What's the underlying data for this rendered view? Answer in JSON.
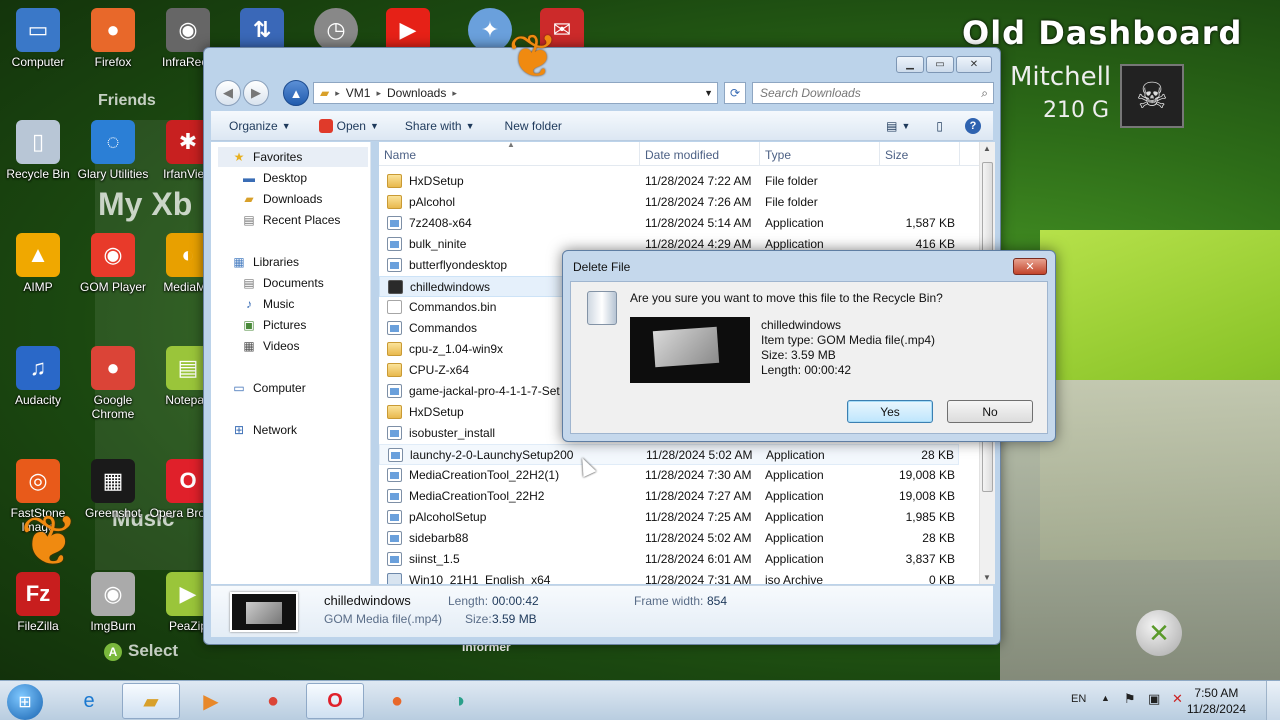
{
  "desktop": {
    "icons": [
      {
        "label": "Computer",
        "glyph": "▭",
        "color": "#3a78c8"
      },
      {
        "label": "Firefox",
        "glyph": "●",
        "color": "#e8682a"
      },
      {
        "label": "InfraReco",
        "glyph": "◉",
        "color": "#666666"
      },
      {
        "label": "Recycle Bin",
        "glyph": "▯",
        "color": "#b8c6d6"
      },
      {
        "label": "Glary Utilities",
        "glyph": "◌",
        "color": "#2b7fd6"
      },
      {
        "label": "IrfanView",
        "glyph": "✱",
        "color": "#c82020"
      },
      {
        "label": "AIMP",
        "glyph": "▲",
        "color": "#f0a800"
      },
      {
        "label": "GOM Player",
        "glyph": "◉",
        "color": "#e83a2a"
      },
      {
        "label": "MediaMo",
        "glyph": "◐",
        "color": "#e8a000"
      },
      {
        "label": "Audacity",
        "glyph": "♫",
        "color": "#2a68c8"
      },
      {
        "label": "Google Chrome",
        "glyph": "●",
        "color": "#db4437"
      },
      {
        "label": "Notepad",
        "glyph": "▤",
        "color": "#9ac53a"
      },
      {
        "label": "FastStone Image",
        "glyph": "◎",
        "color": "#e85a1a"
      },
      {
        "label": "Greenshot",
        "glyph": "▦",
        "color": "#1a1a1a"
      },
      {
        "label": "Opera Browse",
        "glyph": "O",
        "color": "#e0202a"
      },
      {
        "label": "FileZilla",
        "glyph": "Fz",
        "color": "#c81e1e"
      },
      {
        "label": "ImgBurn",
        "glyph": "◉",
        "color": "#aaaaaa"
      },
      {
        "label": "PeaZip",
        "glyph": "▶",
        "color": "#9ac53a"
      }
    ],
    "top_row_icons": [
      "network-icon",
      "clock-icon",
      "youtube-icon",
      "satellite-icon",
      "mail-icon"
    ],
    "gamer_title": "Old Dashboard",
    "gamer_name": "Mitchell",
    "gamer_score": "210 G",
    "bg_texts": {
      "friends": "Friends",
      "my_xbox": "My Xb",
      "music": "Music",
      "select": "Select",
      "informer": "Informer"
    }
  },
  "explorer": {
    "breadcrumb": [
      "VM1",
      "Downloads"
    ],
    "search_placeholder": "Search Downloads",
    "toolbar": {
      "organize": "Organize",
      "open": "Open",
      "share_with": "Share with",
      "new_folder": "New folder"
    },
    "nav": {
      "favorites": "Favorites",
      "desktop": "Desktop",
      "downloads": "Downloads",
      "recent_places": "Recent Places",
      "libraries": "Libraries",
      "documents": "Documents",
      "music": "Music",
      "pictures": "Pictures",
      "videos": "Videos",
      "computer": "Computer",
      "network": "Network"
    },
    "columns": {
      "name": "Name",
      "date": "Date modified",
      "type": "Type",
      "size": "Size"
    },
    "files": [
      {
        "name": "HxDSetup",
        "date": "11/28/2024 7:22 AM",
        "type": "File folder",
        "size": "",
        "icon": "folder"
      },
      {
        "name": "pAlcohol",
        "date": "11/28/2024 7:26 AM",
        "type": "File folder",
        "size": "",
        "icon": "folder"
      },
      {
        "name": "7z2408-x64",
        "date": "11/28/2024 5:14 AM",
        "type": "Application",
        "size": "1,587 KB",
        "icon": "app"
      },
      {
        "name": "bulk_ninite",
        "date": "11/28/2024 4:29 AM",
        "type": "Application",
        "size": "416 KB",
        "icon": "app"
      },
      {
        "name": "butterflyondesktop",
        "date": "",
        "type": "",
        "size": "",
        "icon": "app"
      },
      {
        "name": "chilledwindows",
        "date": "",
        "type": "",
        "size": "",
        "icon": "media"
      },
      {
        "name": "Commandos.bin",
        "date": "",
        "type": "",
        "size": "",
        "icon": "file"
      },
      {
        "name": "Commandos",
        "date": "",
        "type": "",
        "size": "",
        "icon": "app"
      },
      {
        "name": "cpu-z_1.04-win9x",
        "date": "",
        "type": "",
        "size": "",
        "icon": "folder"
      },
      {
        "name": "CPU-Z-x64",
        "date": "",
        "type": "",
        "size": "",
        "icon": "folder"
      },
      {
        "name": "game-jackal-pro-4-1-1-7-Set",
        "date": "",
        "type": "",
        "size": "",
        "icon": "app"
      },
      {
        "name": "HxDSetup",
        "date": "",
        "type": "",
        "size": "",
        "icon": "folder"
      },
      {
        "name": "isobuster_install",
        "date": "",
        "type": "",
        "size": "",
        "icon": "app"
      },
      {
        "name": "launchy-2-0-LaunchySetup200",
        "date": "11/28/2024 5:02 AM",
        "type": "Application",
        "size": "28 KB",
        "icon": "app"
      },
      {
        "name": "MediaCreationTool_22H2(1)",
        "date": "11/28/2024 7:30 AM",
        "type": "Application",
        "size": "19,008 KB",
        "icon": "app"
      },
      {
        "name": "MediaCreationTool_22H2",
        "date": "11/28/2024 7:27 AM",
        "type": "Application",
        "size": "19,008 KB",
        "icon": "app"
      },
      {
        "name": "pAlcoholSetup",
        "date": "11/28/2024 7:25 AM",
        "type": "Application",
        "size": "1,985 KB",
        "icon": "app"
      },
      {
        "name": "sidebarb88",
        "date": "11/28/2024 5:02 AM",
        "type": "Application",
        "size": "28 KB",
        "icon": "app"
      },
      {
        "name": "siinst_1.5",
        "date": "11/28/2024 6:01 AM",
        "type": "Application",
        "size": "3,837 KB",
        "icon": "app"
      },
      {
        "name": "Win10_21H1_English_x64",
        "date": "11/28/2024 7:31 AM",
        "type": "iso Archive",
        "size": "0 KB",
        "icon": "iso"
      }
    ],
    "details": {
      "name": "chilledwindows",
      "type": "GOM Media file(.mp4)",
      "length_label": "Length:",
      "length": "00:00:42",
      "size_label": "Size:",
      "size": "3.59 MB",
      "frame_label": "Frame width:",
      "frame": "854"
    }
  },
  "dialog": {
    "title": "Delete File",
    "question": "Are you sure you want to move this file to the Recycle Bin?",
    "file_name": "chilledwindows",
    "item_type": "Item type: GOM Media file(.mp4)",
    "size": "Size: 3.59 MB",
    "length": "Length: 00:00:42",
    "yes": "Yes",
    "no": "No"
  },
  "taskbar": {
    "lang": "EN",
    "time": "7:50 AM",
    "date": "11/28/2024"
  }
}
